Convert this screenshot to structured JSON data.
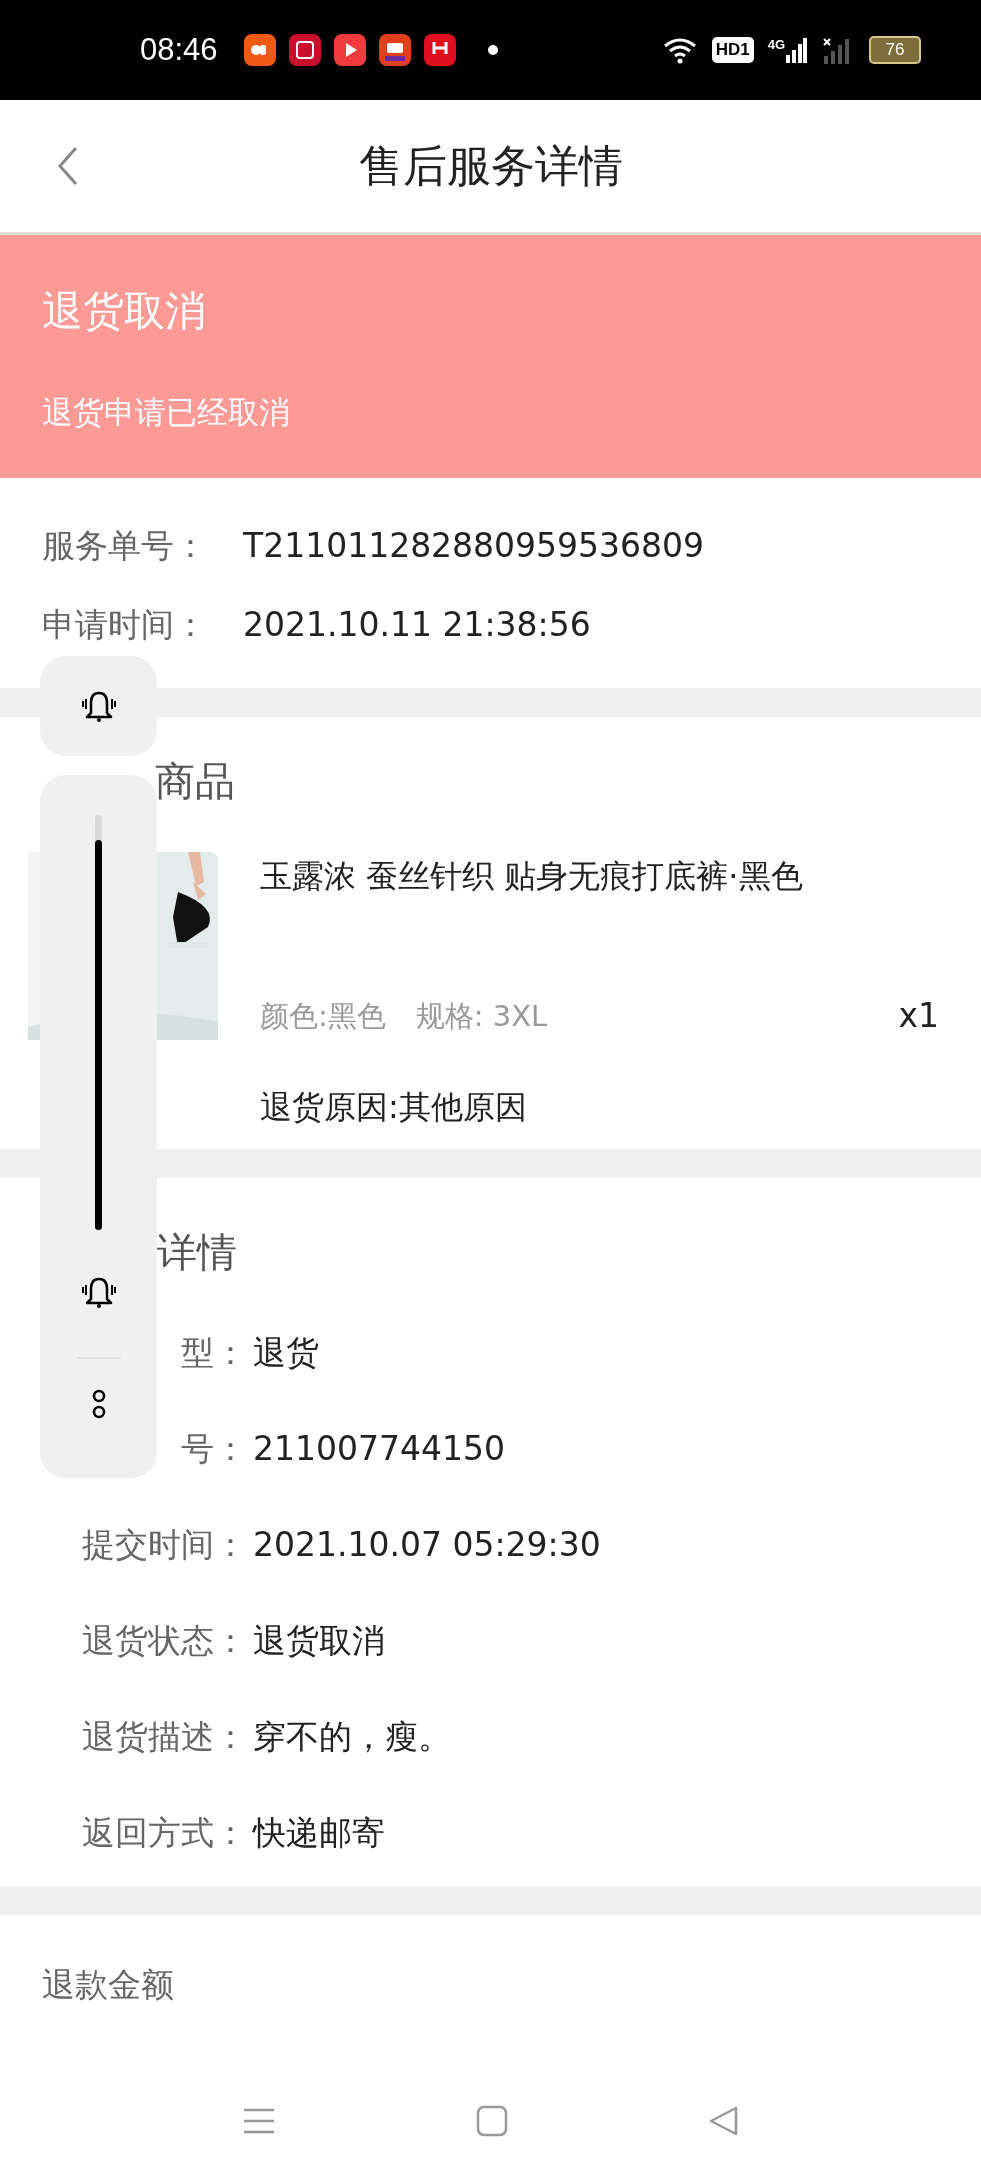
{
  "status_bar": {
    "time": "08:46",
    "network": [
      "HD1",
      "4G"
    ],
    "battery": "76"
  },
  "header": {
    "title": "售后服务详情"
  },
  "banner": {
    "title": "退货取消",
    "subtitle": "退货申请已经取消"
  },
  "service_info": [
    {
      "label": "服务单号：",
      "value": "T211011282880959536809"
    },
    {
      "label": "申请时间：",
      "value": "2021.10.11 21:38:56"
    }
  ],
  "goods": {
    "title": "商品",
    "product": {
      "kind": "picture",
      "name": "玉露浓 蚕丝针织 贴身无痕打底裤·黑色",
      "spec_color": "颜色:黑色",
      "size": "规格: 3XL",
      "quantity": "x1",
      "reason": "退货原因:其他原因"
    }
  },
  "details": {
    "title": "详情",
    "rows": [
      {
        "label": "型：",
        "value": "退货"
      },
      {
        "label": "号：",
        "value": "211007744150"
      },
      {
        "label": "提交时间：",
        "value": "2021.10.07 05:29:30"
      },
      {
        "label": "退货状态：",
        "value": "退货取消"
      },
      {
        "label": "退货描述：",
        "value": "穿不的，瘦。"
      },
      {
        "label": "返回方式：",
        "value": "快递邮寄"
      }
    ]
  },
  "refund": {
    "label": "退款金额"
  },
  "volume_panel": {
    "level": 0.94
  }
}
